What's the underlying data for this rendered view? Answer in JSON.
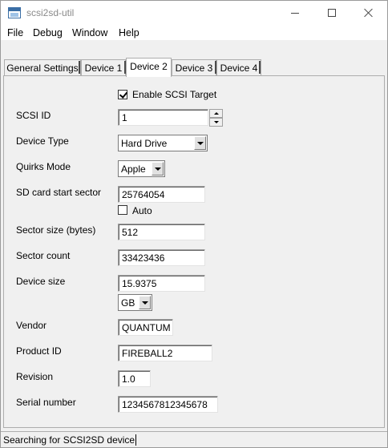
{
  "window": {
    "title": "scsi2sd-util",
    "buttons": {
      "minimize": "minimize-icon",
      "maximize": "maximize-icon",
      "close": "close-icon"
    }
  },
  "menu": [
    "File",
    "Debug",
    "Window",
    "Help"
  ],
  "tabs": [
    {
      "label": "General Settings",
      "active": false
    },
    {
      "label": "Device 1",
      "active": false
    },
    {
      "label": "Device 2",
      "active": true
    },
    {
      "label": "Device 3",
      "active": false
    },
    {
      "label": "Device 4",
      "active": false
    }
  ],
  "form": {
    "enable_target": {
      "label": "Enable SCSI Target",
      "checked": true
    },
    "scsi_id": {
      "label": "SCSI ID",
      "value": "1"
    },
    "device_type": {
      "label": "Device Type",
      "value": "Hard Drive"
    },
    "quirks_mode": {
      "label": "Quirks Mode",
      "value": "Apple"
    },
    "sd_start_sector": {
      "label": "SD card start sector",
      "value": "25764054"
    },
    "auto": {
      "label": "Auto",
      "checked": false
    },
    "sector_size": {
      "label": "Sector size (bytes)",
      "value": "512"
    },
    "sector_count": {
      "label": "Sector count",
      "value": "33423436"
    },
    "device_size": {
      "label": "Device size",
      "value": "15.9375",
      "unit": "GB"
    },
    "vendor": {
      "label": "Vendor",
      "value": "QUANTUM"
    },
    "product_id": {
      "label": "Product ID",
      "value": "FIREBALL2"
    },
    "revision": {
      "label": "Revision",
      "value": "1.0"
    },
    "serial_number": {
      "label": "Serial number",
      "value": "1234567812345678"
    }
  },
  "status": {
    "text": "Searching for SCSI2SD device"
  }
}
